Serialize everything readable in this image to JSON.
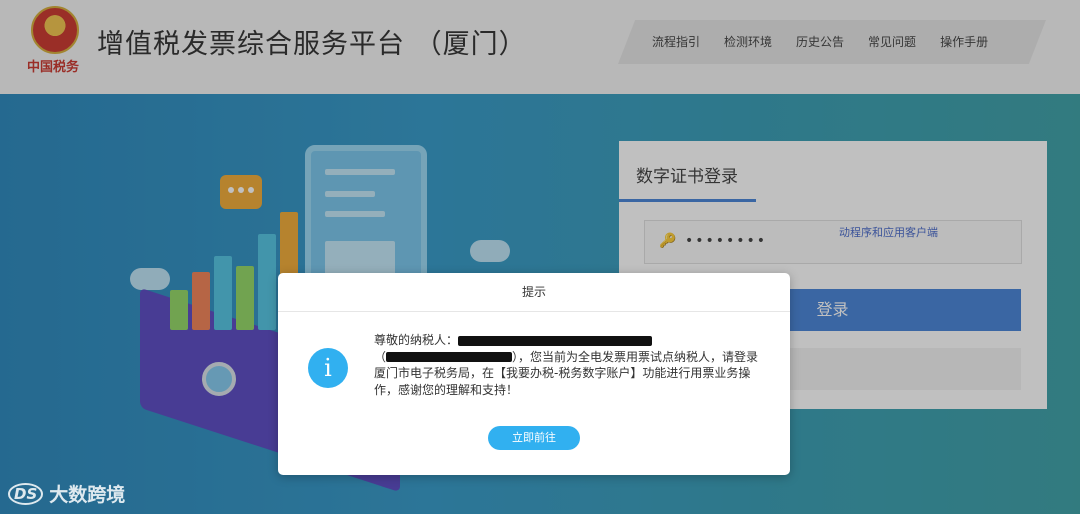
{
  "header": {
    "logo_text": "中国税务",
    "title": "增值税发票综合服务平台 （厦门）",
    "nav": [
      "流程指引",
      "检测环境",
      "历史公告",
      "常见问题",
      "操作手册"
    ]
  },
  "login": {
    "tab_label": "数字证书登录",
    "password_value": "••••••••",
    "login_button": "登录",
    "help_link": "动程序和应用客户端"
  },
  "modal": {
    "title": "提示",
    "salutation": "尊敬的纳税人：",
    "line2_suffix": "），您当前为全电发票用票试点纳税人，请登录",
    "line3": "厦门市电子税务局，在【我要办税-税务数字账户】功能进行用票业务操",
    "line4": "作，感谢您的理解和支持！",
    "open_paren": "（",
    "button": "立即前往"
  },
  "icons": {
    "info": "i",
    "key": "key-icon"
  },
  "watermark": {
    "mark": "DS",
    "text": "大数跨境"
  },
  "colors": {
    "accent_blue": "#3a7bd5",
    "info_blue": "#31b0f0"
  }
}
